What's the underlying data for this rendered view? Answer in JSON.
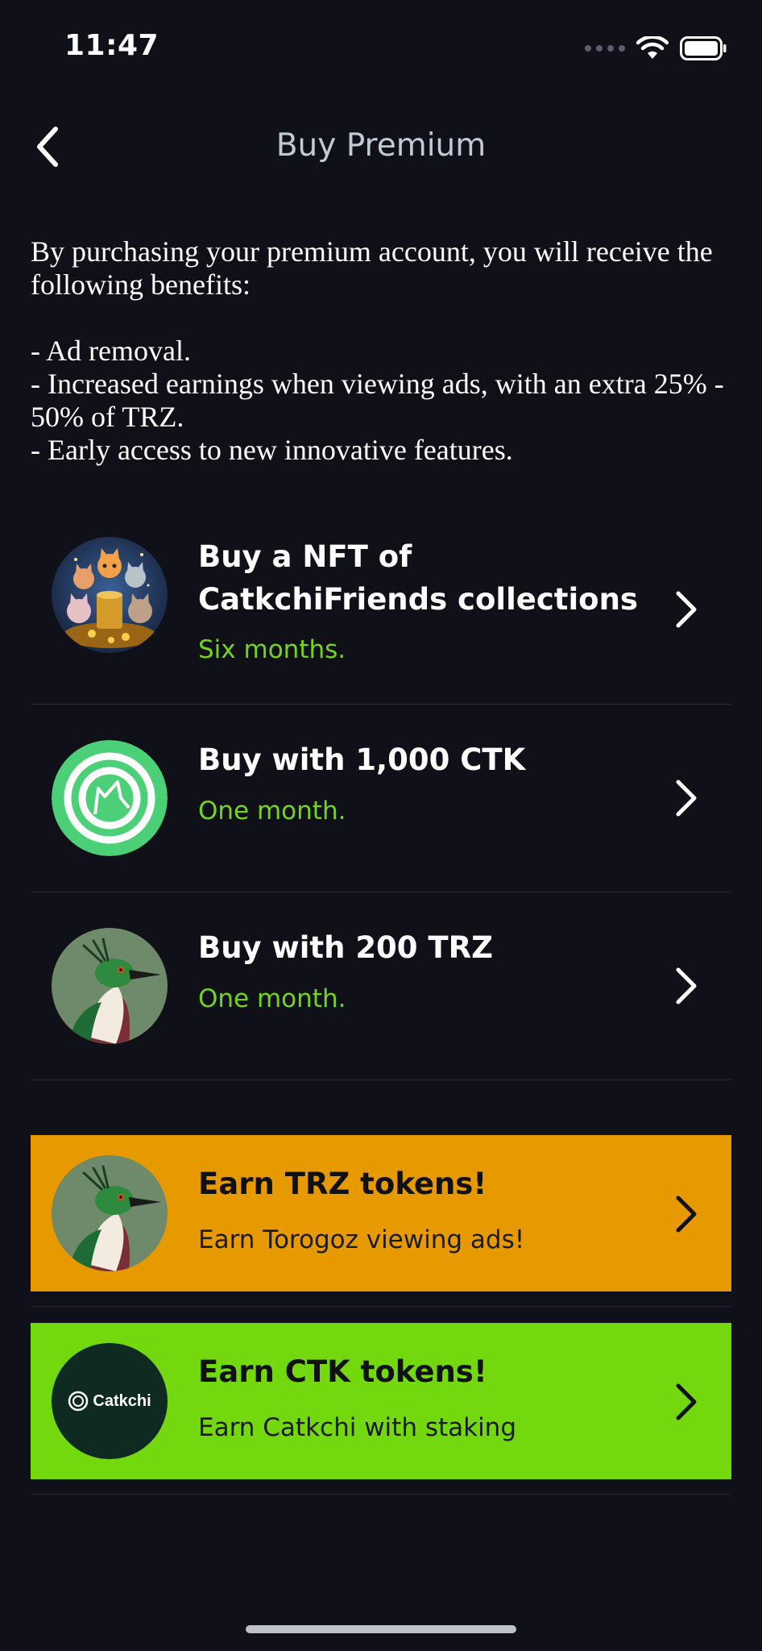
{
  "status_bar": {
    "time": "11:47"
  },
  "header": {
    "title": "Buy Premium"
  },
  "intro": {
    "lead": "By purchasing your premium account, you will receive the following benefits:",
    "benefits": [
      "- Ad removal.",
      "- Increased earnings when viewing ads, with an extra 25% - 50% of TRZ.",
      "- Early access to new innovative features."
    ]
  },
  "options": [
    {
      "title": "Buy a NFT of CatkchiFriends collections",
      "subtitle": "Six months.",
      "icon": "cat-nft-icon"
    },
    {
      "title": "Buy with 1,000 CTK",
      "subtitle": "One month.",
      "icon": "ctk-token-icon"
    },
    {
      "title": "Buy with 200 TRZ",
      "subtitle": "One month.",
      "icon": "torogoz-bird-icon"
    }
  ],
  "promos": [
    {
      "title": "Earn TRZ tokens!",
      "subtitle": "Earn Torogoz viewing ads!",
      "bg": "#e69a00",
      "icon": "torogoz-bird-icon"
    },
    {
      "title": "Earn CTK tokens!",
      "subtitle": "Earn Catkchi with staking",
      "bg": "#74d80f",
      "icon": "catkchi-logo-icon",
      "logo_text": "Catkchi"
    }
  ],
  "colors": {
    "background": "#0f1018",
    "accent_green": "#74d41a",
    "title_gray": "#c2cad4"
  }
}
